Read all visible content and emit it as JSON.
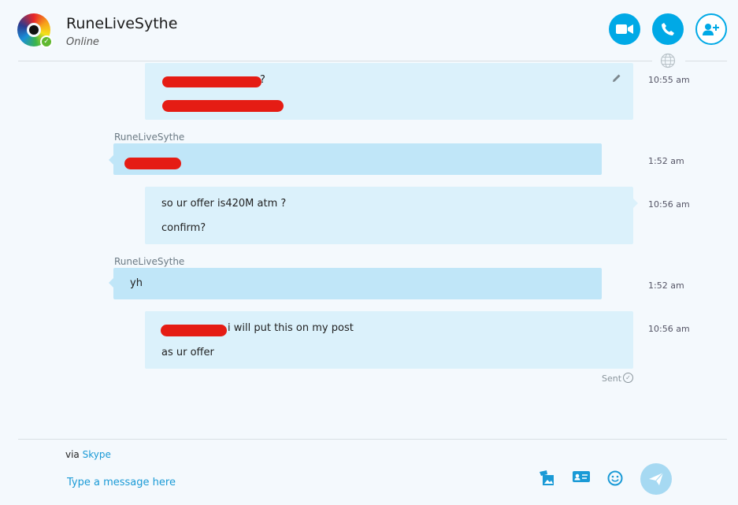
{
  "header": {
    "contact_name": "RuneLiveSythe",
    "status": "Online"
  },
  "messages": [
    {
      "direction": "outgoing",
      "lines": [
        "?",
        ""
      ],
      "time": "10:55 am"
    },
    {
      "direction": "incoming",
      "sender": "RuneLiveSythe",
      "lines": [
        ""
      ],
      "time": "1:52 am"
    },
    {
      "direction": "outgoing",
      "lines": [
        "so ur offer is420M atm ?",
        "confirm?"
      ],
      "time": "10:56 am"
    },
    {
      "direction": "incoming",
      "sender": "RuneLiveSythe",
      "lines": [
        "yh"
      ],
      "time": "1:52 am"
    },
    {
      "direction": "outgoing",
      "lines": [
        "i will put this on my post",
        "as ur offer"
      ],
      "time": "10:56 am"
    }
  ],
  "delivery_status": "Sent",
  "composer": {
    "via_prefix": "via",
    "via_link": "Skype",
    "placeholder": "Type a message here"
  },
  "colors": {
    "accent": "#00a9e6",
    "outgoing_bubble": "#dbf1fb",
    "incoming_bubble": "#c0e6f8",
    "redaction": "#e51c14"
  },
  "icons": {
    "video_call": "video-camera-icon",
    "voice_call": "phone-icon",
    "add_people": "add-person-icon",
    "translate": "globe-icon",
    "edit": "pencil-icon",
    "send_image": "image-icon",
    "send_contact": "contact-card-icon",
    "emoticons": "smiley-icon",
    "send": "send-icon"
  }
}
